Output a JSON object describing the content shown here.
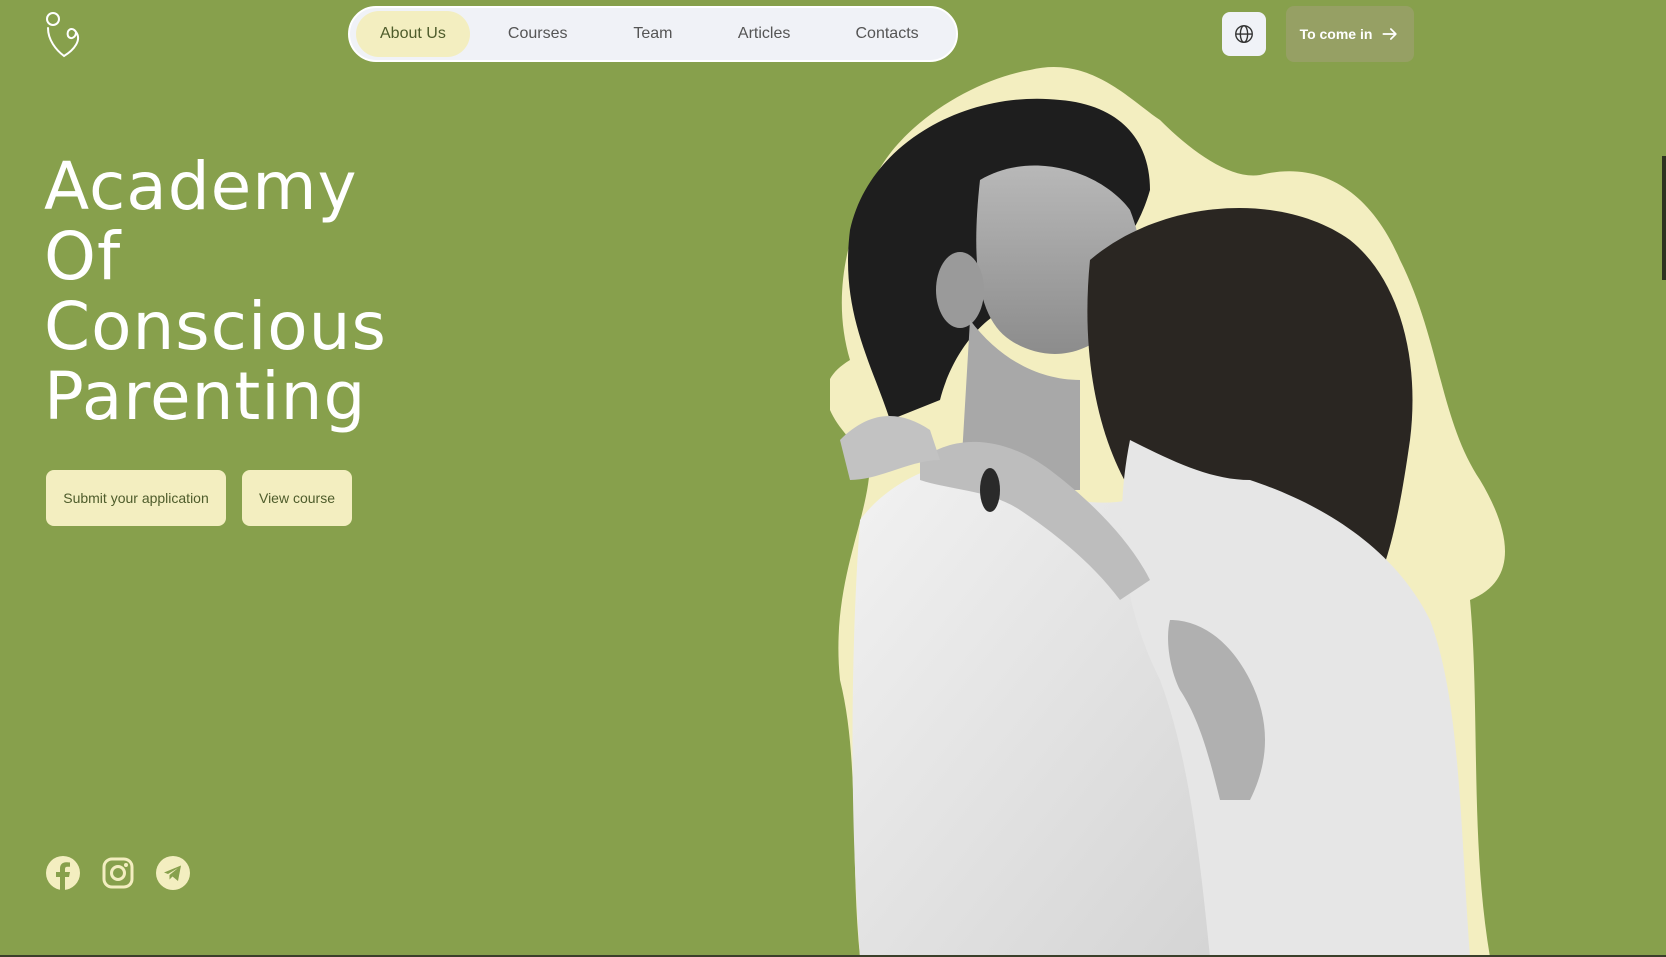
{
  "colors": {
    "background": "#87a04c",
    "cream": "#f3eec0",
    "nav_bg": "#f0f2f7",
    "login_bg": "#96a064",
    "text_dark": "#4e5c2b"
  },
  "header": {
    "logo_icon": "mother-child-logo-icon",
    "nav": [
      {
        "label": "About Us",
        "active": true
      },
      {
        "label": "Courses",
        "active": false
      },
      {
        "label": "Team",
        "active": false
      },
      {
        "label": "Articles",
        "active": false
      },
      {
        "label": "Contacts",
        "active": false
      }
    ],
    "language_icon": "globe-icon",
    "login_label": "To come in",
    "login_icon": "arrow-right-icon"
  },
  "hero": {
    "title_lines": [
      "Academy",
      "Of",
      "Conscious",
      "Parenting"
    ],
    "primary_button": "Submit your application",
    "secondary_button": "View course"
  },
  "socials": [
    {
      "icon": "facebook-icon"
    },
    {
      "icon": "instagram-icon"
    },
    {
      "icon": "telegram-icon"
    }
  ]
}
